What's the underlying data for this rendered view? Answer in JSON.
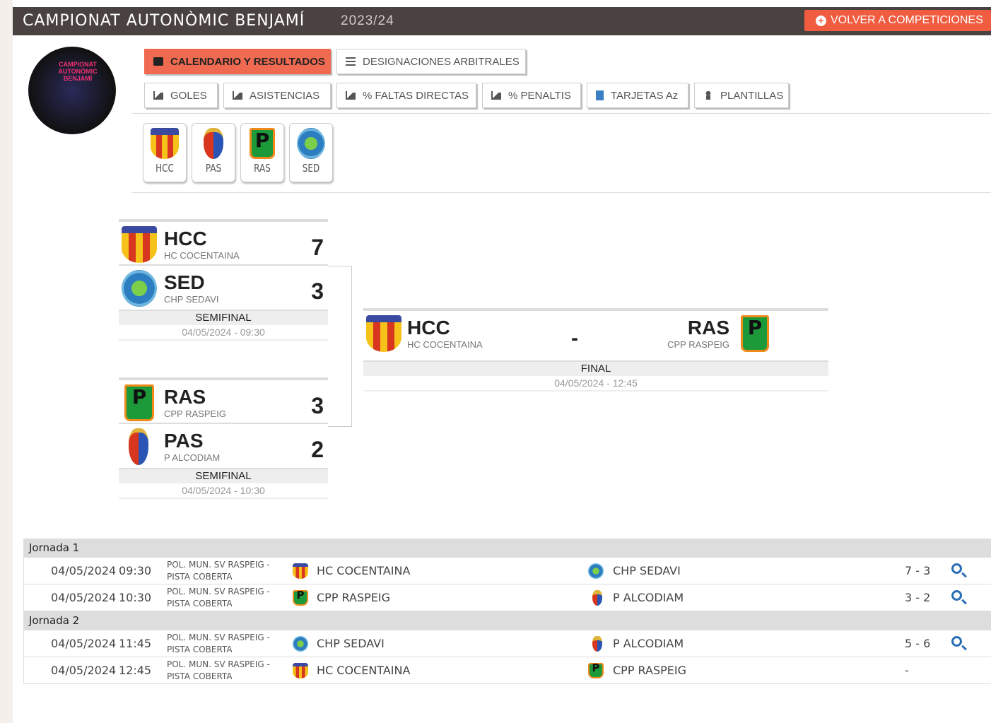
{
  "header": {
    "title": "CAMPIONAT AUTONÒMIC BENJAMÍ",
    "season": "2023/24",
    "back_button": "VOLVER A COMPETICIONES"
  },
  "logo": {
    "text": "CAMPIONAT AUTONÒMIC BENJAMÍ"
  },
  "tabs_primary": [
    {
      "label": "CALENDARIO Y RESULTADOS",
      "icon": "calendar-icon",
      "active": true
    },
    {
      "label": "DESIGNACIONES ARBITRALES",
      "icon": "list-icon",
      "active": false
    }
  ],
  "tabs_secondary": [
    {
      "label": "GOLES",
      "icon": "chart-icon"
    },
    {
      "label": "ASISTENCIAS",
      "icon": "chart-icon"
    },
    {
      "label": "% FALTAS DIRECTAS",
      "icon": "chart-icon"
    },
    {
      "label": "% PENALTIS",
      "icon": "chart-icon"
    },
    {
      "label": "TARJETAS Az",
      "icon": "document-icon"
    },
    {
      "label": "PLANTILLAS",
      "icon": "person-icon"
    }
  ],
  "teams": [
    {
      "abbr": "HCC"
    },
    {
      "abbr": "PAS"
    },
    {
      "abbr": "RAS"
    },
    {
      "abbr": "SED"
    }
  ],
  "semifinals": [
    {
      "home": {
        "abbr": "HCC",
        "name": "HC COCENTAINA",
        "score": "7"
      },
      "away": {
        "abbr": "SED",
        "name": "CHP SEDAVI",
        "score": "3"
      },
      "round": "SEMIFINAL",
      "date": "04/05/2024 - 09:30"
    },
    {
      "home": {
        "abbr": "RAS",
        "name": "CPP RASPEIG",
        "score": "3"
      },
      "away": {
        "abbr": "PAS",
        "name": "P ALCODIAM",
        "score": "2"
      },
      "round": "SEMIFINAL",
      "date": "04/05/2024 - 10:30"
    }
  ],
  "final": {
    "home": {
      "abbr": "HCC",
      "name": "HC COCENTAINA"
    },
    "away": {
      "abbr": "RAS",
      "name": "CPP RASPEIG"
    },
    "score": "-",
    "round": "FINAL",
    "date": "04/05/2024 - 12:45"
  },
  "jornadas": [
    {
      "label": "Jornada 1",
      "matches": [
        {
          "date": "04/05/2024",
          "time": "09:30",
          "venue": "POL. MUN. SV RASPEIG - PISTA COBERTA",
          "home": "HC COCENTAINA",
          "away": "CHP SEDAVI",
          "score": "7 - 3"
        },
        {
          "date": "04/05/2024",
          "time": "10:30",
          "venue": "POL. MUN. SV RASPEIG - PISTA COBERTA",
          "home": "CPP RASPEIG",
          "away": "P ALCODIAM",
          "score": "3 - 2"
        }
      ]
    },
    {
      "label": "Jornada 2",
      "matches": [
        {
          "date": "04/05/2024",
          "time": "11:45",
          "venue": "POL. MUN. SV RASPEIG - PISTA COBERTA",
          "home": "CHP SEDAVI",
          "away": "P ALCODIAM",
          "score": "5 - 6"
        },
        {
          "date": "04/05/2024",
          "time": "12:45",
          "venue": "POL. MUN. SV RASPEIG - PISTA COBERTA",
          "home": "HC COCENTAINA",
          "away": "CPP RASPEIG",
          "score": "-"
        }
      ]
    }
  ],
  "colors": {
    "header_bg": "#4a4241",
    "accent": "#ef5c40",
    "link": "#2a6fb5"
  }
}
